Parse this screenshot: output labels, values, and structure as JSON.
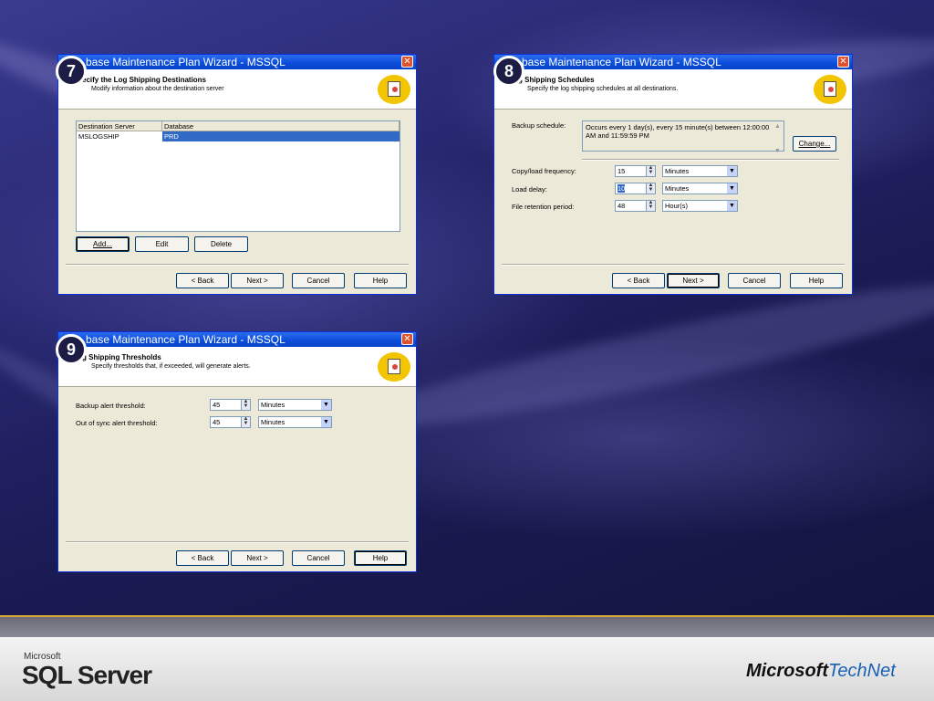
{
  "background": {
    "accent": "#1a1a52",
    "footer_line": "#d8a830"
  },
  "footer": {
    "microsoft_small": "Microsoft",
    "sql_server": "SQL Server",
    "technet_ms": "Microsoft",
    "technet_tn": "TechNet"
  },
  "dialogs": [
    {
      "step": "7",
      "title": "base Maintenance Plan Wizard - MSSQL",
      "header_title": "ecify the Log Shipping Destinations",
      "header_sub": "Modify information about the destination server",
      "grid": {
        "columns": [
          "Destination Server",
          "Database"
        ],
        "rows": [
          [
            "MSLOGSHIP",
            "PRD"
          ]
        ]
      },
      "buttons": {
        "add": "Add...",
        "edit": "Edit",
        "delete": "Delete"
      },
      "nav": {
        "back": "< Back",
        "next": "Next >",
        "cancel": "Cancel",
        "help": "Help"
      }
    },
    {
      "step": "8",
      "title": "base Maintenance Plan Wizard - MSSQL",
      "header_title": "g Shipping Schedules",
      "header_sub": "Specify the log shipping schedules at all destinations.",
      "backup_schedule_label": "Backup schedule:",
      "backup_schedule_text": "Occurs every 1 day(s), every 15 minute(s) between 12:00:00 AM and 11:59:59 PM",
      "change_button": "Change...",
      "fields": [
        {
          "label": "Copy/load frequency:",
          "value": "15",
          "unit": "Minutes"
        },
        {
          "label": "Load delay:",
          "value": "10",
          "unit": "Minutes"
        },
        {
          "label": "File retention period:",
          "value": "48",
          "unit": "Hour(s)"
        }
      ],
      "nav": {
        "back": "< Back",
        "next": "Next >",
        "cancel": "Cancel",
        "help": "Help"
      }
    },
    {
      "step": "9",
      "title": "base Maintenance Plan Wizard - MSSQL",
      "header_title": "g Shipping Thresholds",
      "header_sub": "Specify thresholds that, if exceeded, will generate alerts.",
      "fields": [
        {
          "label": "Backup alert threshold:",
          "value": "45",
          "unit": "Minutes"
        },
        {
          "label": "Out of sync alert threshold:",
          "value": "45",
          "unit": "Minutes"
        }
      ],
      "nav": {
        "back": "< Back",
        "next": "Next >",
        "cancel": "Cancel",
        "help": "Help"
      }
    }
  ]
}
